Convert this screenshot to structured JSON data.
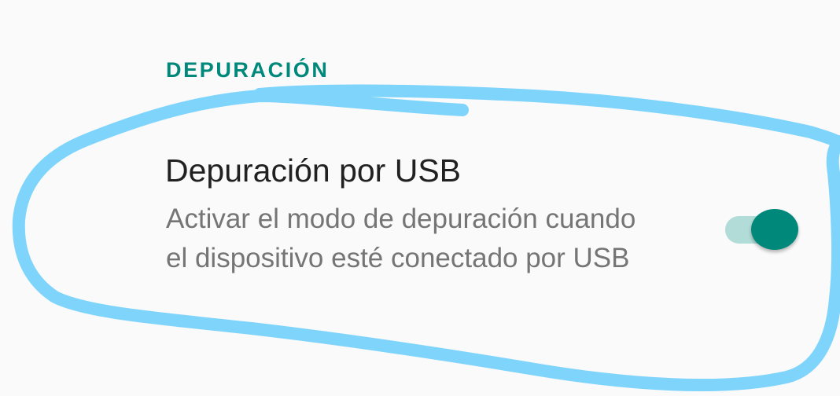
{
  "section": {
    "header": "DEPURACIÓN"
  },
  "usb_debugging": {
    "title": "Depuración por USB",
    "summary": "Activar el modo de depuración cuando el dispositivo esté conectado por USB",
    "enabled": true
  },
  "colors": {
    "accent": "#00897b",
    "track_on": "#b2dcd7",
    "annotation": "#7fd4fc",
    "background": "#fafafa",
    "title_text": "#212121",
    "summary_text": "#757575"
  }
}
